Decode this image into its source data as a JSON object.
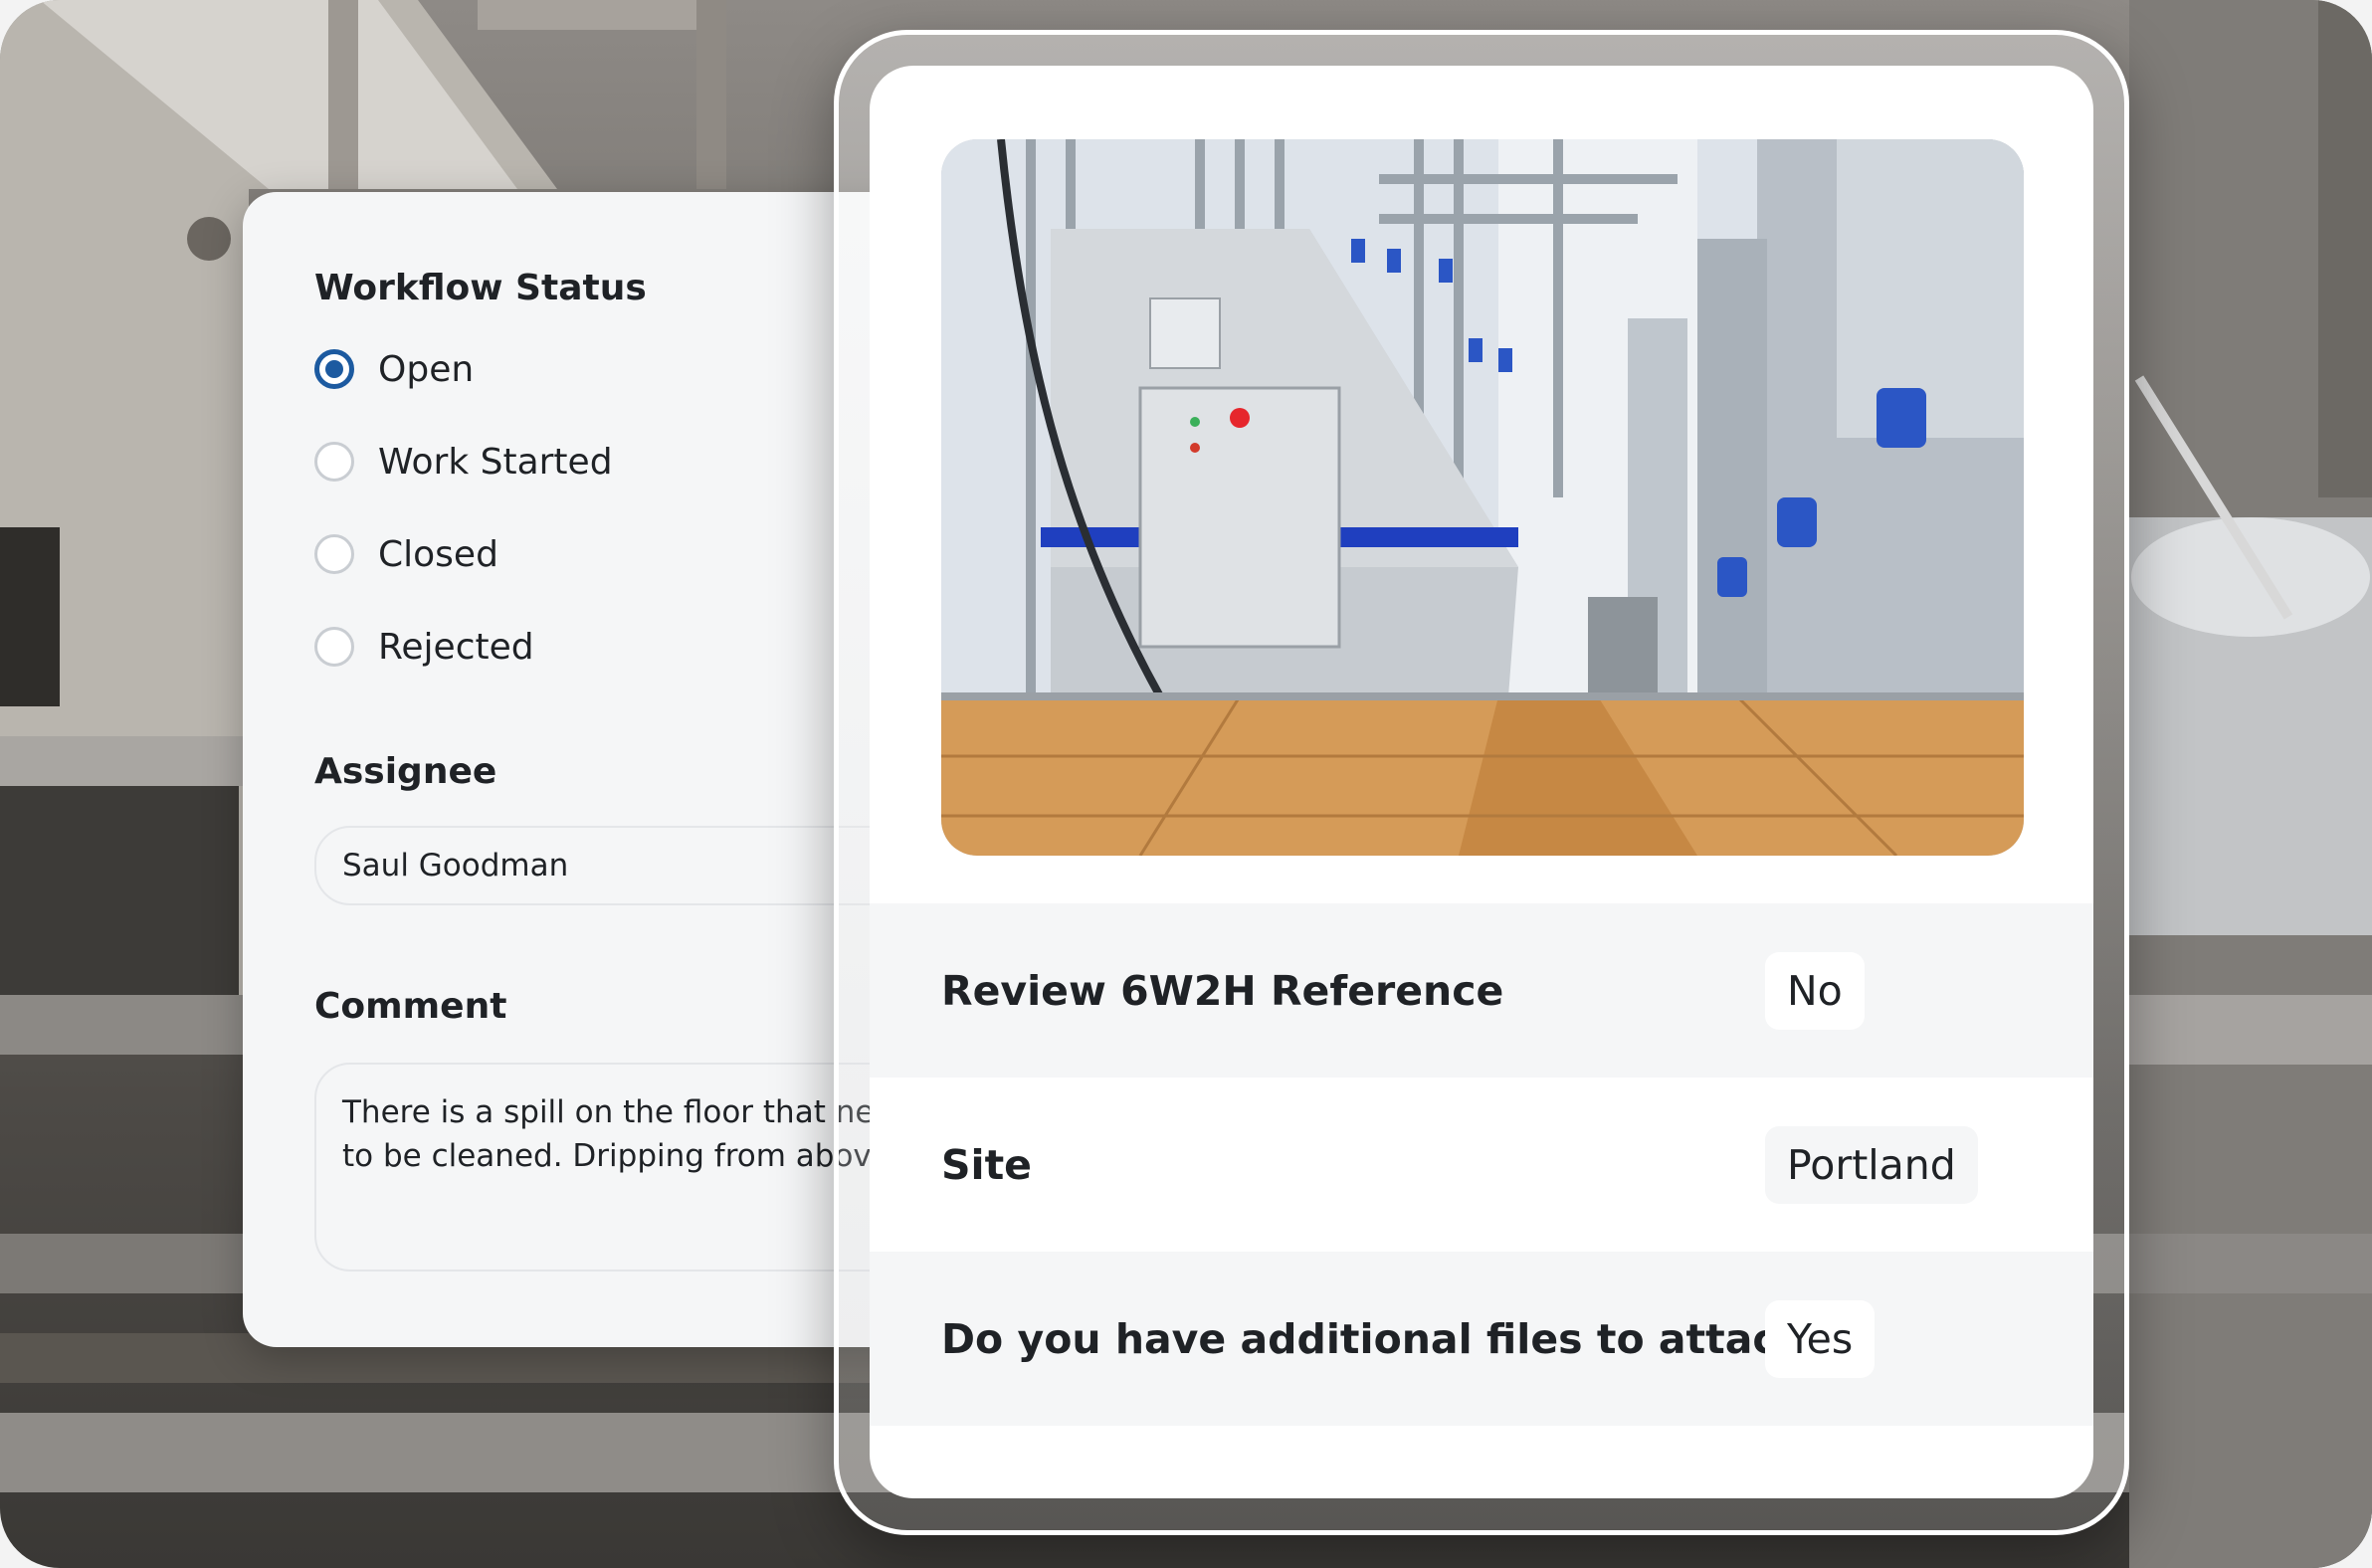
{
  "form": {
    "workflow_status": {
      "title": "Workflow Status",
      "options": [
        {
          "label": "Open",
          "selected": true
        },
        {
          "label": "Work Started",
          "selected": false
        },
        {
          "label": "Closed",
          "selected": false
        },
        {
          "label": "Rejected",
          "selected": false
        }
      ]
    },
    "assignee": {
      "title": "Assignee",
      "value": "Saul Goodman"
    },
    "comment": {
      "title": "Comment",
      "value": "There is a spill on the floor that needs\nto be cleaned. Dripping from above."
    }
  },
  "detail": {
    "photo_icon": "factory-photo",
    "rows": [
      {
        "label": "Review 6W2H Reference",
        "value": "No"
      },
      {
        "label": "Site",
        "value": "Portland"
      },
      {
        "label": "Do you have additional files to attach?",
        "value": "Yes"
      }
    ]
  },
  "colors": {
    "accent": "#1c5aa0",
    "card_bg": "#f5f6f7",
    "text": "#1f2226"
  }
}
